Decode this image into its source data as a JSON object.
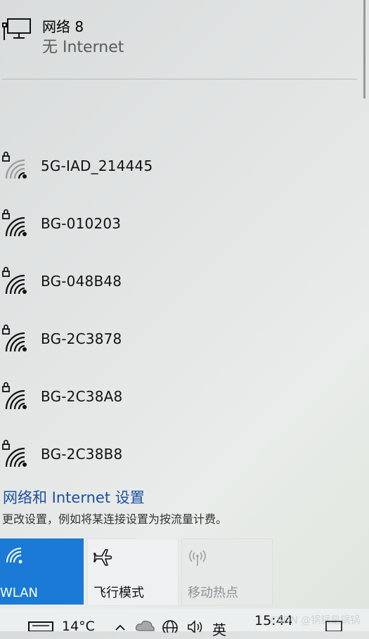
{
  "current_network": {
    "name": "网络 8",
    "status": "无 Internet"
  },
  "networks": [
    {
      "ssid": "5G-IAD_214445",
      "secured": true,
      "signal": "weak"
    },
    {
      "ssid": "BG-010203",
      "secured": true,
      "signal": "full"
    },
    {
      "ssid": "BG-048B48",
      "secured": true,
      "signal": "full"
    },
    {
      "ssid": "BG-2C3878",
      "secured": true,
      "signal": "full"
    },
    {
      "ssid": "BG-2C38A8",
      "secured": true,
      "signal": "full"
    },
    {
      "ssid": "BG-2C38B8",
      "secured": true,
      "signal": "full"
    }
  ],
  "settings": {
    "link": "网络和 Internet 设置",
    "description": "更改设置，例如将某连接设置为按流量计费。"
  },
  "quick_actions": [
    {
      "label": "WLAN",
      "icon": "wifi-icon",
      "active": true
    },
    {
      "label": "飞行模式",
      "icon": "airplane-icon",
      "active": false
    },
    {
      "label": "移动热点",
      "icon": "hotspot-icon",
      "active": false,
      "disabled": true
    }
  ],
  "taskbar": {
    "temperature": "14°C",
    "ime": "英",
    "time": "15:44",
    "watermark": "CSDN @锅锅是锅锅"
  },
  "colors": {
    "accent": "#1a7ad6",
    "link": "#1a4f9c"
  }
}
